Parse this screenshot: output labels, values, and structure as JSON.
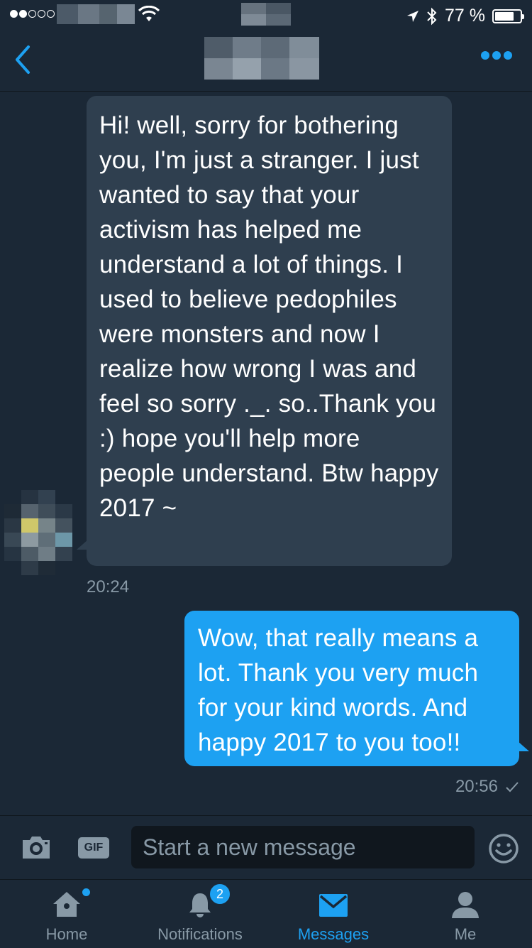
{
  "status_bar": {
    "signal_dots": "●●○○○",
    "battery_percent": "77 %",
    "battery_level": 0.77
  },
  "nav": {
    "back_icon": "chevron-left-icon",
    "more_icon": "more-dots-icon"
  },
  "conversation": {
    "incoming": {
      "text": "Hi! well, sorry for bothering you, I'm just a stranger. I just wanted to say that your activism has helped me understand a lot of things. I used to believe pedophiles were monsters and now I realize how wrong I was and feel so sorry ._. so..Thank you :) hope you'll help more people understand. Btw happy 2017 ~",
      "time": "20:24"
    },
    "outgoing": {
      "text": "Wow, that really means a lot. Thank you very much for your kind words. And happy 2017 to you too!!",
      "time": "20:56",
      "status_icon": "checkmark-icon"
    }
  },
  "compose": {
    "placeholder": "Start a new message",
    "gif_label": "GIF"
  },
  "tabs": [
    {
      "label": "Home",
      "icon": "home-icon",
      "has_dot": true
    },
    {
      "label": "Notifications",
      "icon": "bell-icon",
      "badge": "2"
    },
    {
      "label": "Messages",
      "icon": "envelope-icon",
      "active": true
    },
    {
      "label": "Me",
      "icon": "person-icon"
    }
  ],
  "colors": {
    "background": "#1b2836",
    "accent": "#1da1f2",
    "incoming_bubble": "#2f3f4f",
    "muted": "#8899a6"
  }
}
